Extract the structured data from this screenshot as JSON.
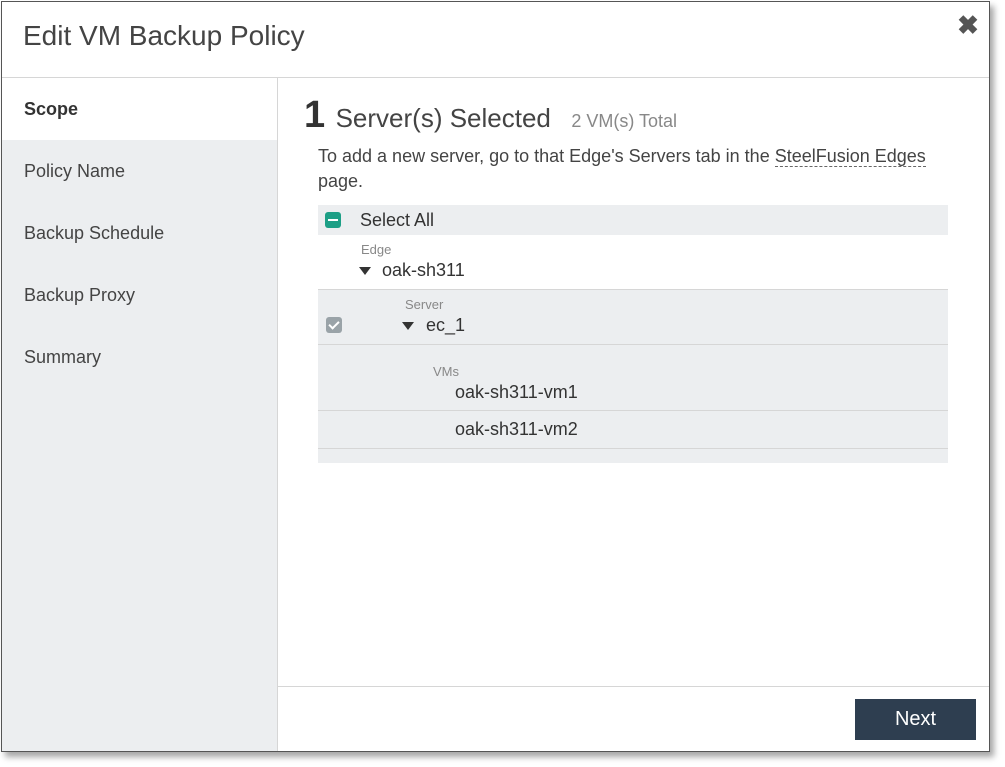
{
  "dialog": {
    "title": "Edit VM Backup Policy",
    "close_icon": "close-icon"
  },
  "sidebar": {
    "items": [
      {
        "label": "Scope",
        "active": true
      },
      {
        "label": "Policy Name",
        "active": false
      },
      {
        "label": "Backup Schedule",
        "active": false
      },
      {
        "label": "Backup Proxy",
        "active": false
      },
      {
        "label": "Summary",
        "active": false
      }
    ]
  },
  "main": {
    "selected_count": "1",
    "selected_label": "Server(s) Selected",
    "total_label": "2 VM(s) Total",
    "info_text_before": "To add a new server, go to that Edge's Servers tab in the ",
    "info_link": "SteelFusion Edges",
    "info_text_after": " page.",
    "tree": {
      "select_all_label": "Select All",
      "edge_label": "Edge",
      "edge_name": "oak-sh311",
      "server_label": "Server",
      "server_name": "ec_1",
      "vms_label": "VMs",
      "vms": [
        "oak-sh311-vm1",
        "oak-sh311-vm2"
      ]
    }
  },
  "footer": {
    "next_label": "Next"
  },
  "colors": {
    "accent": "#1d9f86",
    "button": "#2e3e50",
    "sidebar_bg": "#eceef0"
  }
}
